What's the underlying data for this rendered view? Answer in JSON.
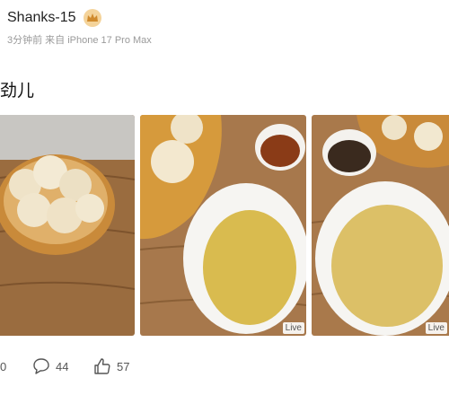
{
  "post": {
    "username": "Shanks-15",
    "vip_badge_icon": "crown-icon",
    "meta": "3分钟前 来自 iPhone 17 Pro Max",
    "text": "劲儿"
  },
  "photos": [
    {
      "live_label": ""
    },
    {
      "live_label": "Live"
    },
    {
      "live_label": "Live"
    }
  ],
  "actions": {
    "repost_count": "0",
    "comment_count": "44",
    "like_count": "57"
  }
}
